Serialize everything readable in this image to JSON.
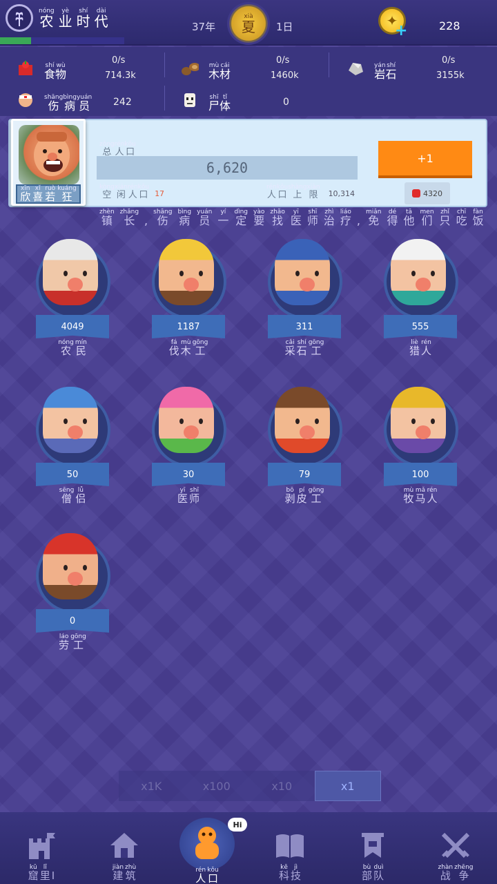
{
  "header": {
    "era_title": [
      [
        "nóng",
        "农"
      ],
      [
        "yè",
        "业"
      ],
      [
        "shí",
        "时"
      ],
      [
        "dài",
        "代"
      ]
    ],
    "era_progress": 0.25,
    "year": "37年",
    "season": {
      "py": "xià",
      "ch": "夏"
    },
    "day": "1日",
    "coins": "228",
    "icons": {
      "era": "wheat-icon",
      "season": "sun-medal-icon",
      "coin": "gold-coin-icon",
      "coin_add": "plus-icon"
    }
  },
  "resources": {
    "food": {
      "name": [
        [
          "shí",
          "食"
        ],
        [
          "wù",
          "物"
        ]
      ],
      "rate": "0/s",
      "amount": "714.3k",
      "icon": "apple-crate-icon"
    },
    "wood": {
      "name": [
        [
          "mù",
          "木"
        ],
        [
          "cái",
          "材"
        ]
      ],
      "rate": "0/s",
      "amount": "1460k",
      "icon": "log-icon"
    },
    "stone": {
      "name": [
        [
          "yán",
          "岩"
        ],
        [
          "shí",
          "石"
        ]
      ],
      "rate": "0/s",
      "amount": "3155k",
      "icon": "rock-icon"
    },
    "wounded": {
      "name": [
        [
          "shāng",
          "伤"
        ],
        [
          "bìng",
          "病"
        ],
        [
          "yuán",
          "员"
        ]
      ],
      "amount": "242",
      "icon": "injured-person-icon"
    },
    "corpse": {
      "name": [
        [
          "shī",
          "尸"
        ],
        [
          "tǐ",
          "体"
        ]
      ],
      "amount": "0",
      "icon": "skull-icon"
    }
  },
  "population": {
    "total_label": [
      [
        "zǒng",
        "总"
      ],
      [
        "rén",
        "人"
      ],
      [
        "kǒu",
        "口"
      ]
    ],
    "total": "6,620",
    "idle_label": [
      [
        "kòng",
        "空"
      ],
      [
        "xián",
        "闲"
      ],
      [
        "rén",
        "人"
      ],
      [
        "kǒu",
        "口"
      ]
    ],
    "idle": "17",
    "cap_label": [
      [
        "rén",
        "人"
      ],
      [
        "kǒu",
        "口"
      ],
      [
        "shàng",
        "上"
      ],
      [
        "xiàn",
        "限"
      ]
    ],
    "cap": "10,314",
    "add_button": "+1",
    "cost": "4320",
    "mood": [
      [
        "xīn",
        "欣"
      ],
      [
        "xǐ",
        "喜"
      ],
      [
        "ruò",
        "若"
      ],
      [
        "kuáng",
        "狂"
      ]
    ]
  },
  "tip": [
    [
      "zhèn",
      "镇"
    ],
    [
      "zhǎng",
      "长"
    ],
    [
      "",
      ","
    ],
    [
      "shāng",
      "伤"
    ],
    [
      "bìng",
      "病"
    ],
    [
      "yuán",
      "员"
    ],
    [
      "yí",
      "一"
    ],
    [
      "dìng",
      "定"
    ],
    [
      "yào",
      "要"
    ],
    [
      "zhǎo",
      "找"
    ],
    [
      "yī",
      "医"
    ],
    [
      "shī",
      "师"
    ],
    [
      "zhì",
      "治"
    ],
    [
      "liáo",
      "疗"
    ],
    [
      "",
      ","
    ],
    [
      "miǎn",
      "免"
    ],
    [
      "dé",
      "得"
    ],
    [
      "tā",
      "他"
    ],
    [
      "men",
      "们"
    ],
    [
      "zhǐ",
      "只"
    ],
    [
      "chī",
      "吃"
    ],
    [
      "fàn",
      "饭"
    ]
  ],
  "units": [
    {
      "name": [
        [
          "nóng",
          "农"
        ],
        [
          "mín",
          "民"
        ]
      ],
      "count": "4049"
    },
    {
      "name": [
        [
          "fá",
          "伐"
        ],
        [
          "mù",
          "木"
        ],
        [
          "gōng",
          "工"
        ]
      ],
      "count": "1187"
    },
    {
      "name": [
        [
          "cǎi",
          "采"
        ],
        [
          "shí",
          "石"
        ],
        [
          "gōng",
          "工"
        ]
      ],
      "count": "311"
    },
    {
      "name": [
        [
          "liè",
          "猎"
        ],
        [
          "rén",
          "人"
        ]
      ],
      "count": "555"
    },
    {
      "name": [
        [
          "sēng",
          "僧"
        ],
        [
          "lǚ",
          "侣"
        ]
      ],
      "count": "50"
    },
    {
      "name": [
        [
          "yī",
          "医"
        ],
        [
          "shī",
          "师"
        ]
      ],
      "count": "30"
    },
    {
      "name": [
        [
          "bō",
          "剥"
        ],
        [
          "pí",
          "皮"
        ],
        [
          "gōng",
          "工"
        ]
      ],
      "count": "79"
    },
    {
      "name": [
        [
          "mù",
          "牧"
        ],
        [
          "mǎ",
          "马"
        ],
        [
          "rén",
          "人"
        ]
      ],
      "count": "100"
    },
    {
      "name": [
        [
          "láo",
          "劳"
        ],
        [
          "gōng",
          "工"
        ]
      ],
      "count": "0"
    }
  ],
  "multiplier": {
    "options": [
      "x1K",
      "x100",
      "x10",
      "x1"
    ],
    "active": "x1"
  },
  "nav": [
    {
      "label": [
        [
          "kū",
          "窟"
        ],
        [
          "lǐ",
          "里"
        ],
        [
          "",
          "I"
        ]
      ],
      "icon": "castle-icon"
    },
    {
      "label": [
        [
          "jiàn",
          "建"
        ],
        [
          "zhù",
          "筑"
        ]
      ],
      "icon": "house-icon"
    },
    {
      "label": [
        [
          "rén",
          "人"
        ],
        [
          "kǒu",
          "口"
        ]
      ],
      "icon": "gingerbread-person-icon",
      "bubble": "Hi"
    },
    {
      "label": [
        [
          "kē",
          "科"
        ],
        [
          "jì",
          "技"
        ]
      ],
      "icon": "book-icon"
    },
    {
      "label": [
        [
          "bù",
          "部"
        ],
        [
          "duì",
          "队"
        ]
      ],
      "icon": "banner-icon"
    },
    {
      "label": [
        [
          "zhàn",
          "战"
        ],
        [
          "zhēng",
          "争"
        ]
      ],
      "icon": "crossed-swords-icon"
    }
  ]
}
